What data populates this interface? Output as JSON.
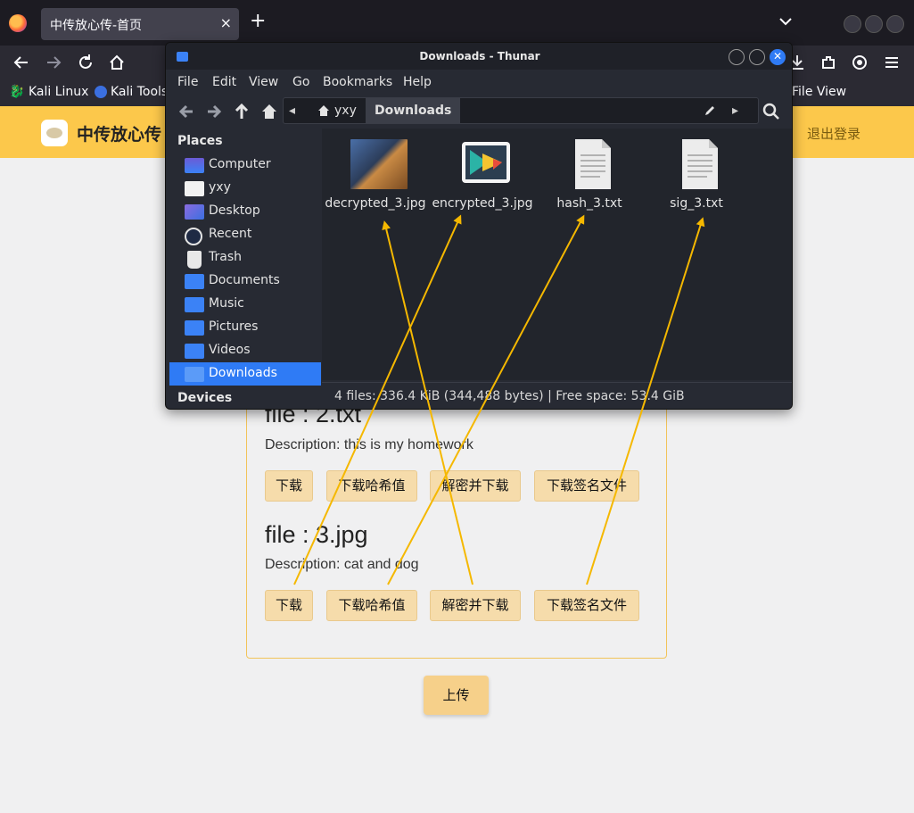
{
  "browser": {
    "tab_title": "中传放心传-首页",
    "tab_close": "×",
    "new_tab": "+",
    "bookmarks": [
      "Kali Linux",
      "Kali Tools",
      "File View"
    ]
  },
  "site": {
    "title": "中传放心传",
    "logout": "退出登录"
  },
  "files": [
    {
      "title": "file : 2.txt",
      "description": "Description: this is my homework",
      "buttons": [
        "下载",
        "下载哈希值",
        "解密并下载",
        "下载签名文件"
      ]
    },
    {
      "title": "file : 3.jpg",
      "description": "Description: cat and dog",
      "buttons": [
        "下载",
        "下载哈希值",
        "解密并下载",
        "下载签名文件"
      ]
    }
  ],
  "upload_button": "上传",
  "thunar": {
    "window_title": "Downloads - Thunar",
    "menu": [
      "File",
      "Edit",
      "View",
      "Go",
      "Bookmarks",
      "Help"
    ],
    "path": [
      "yxy",
      "Downloads"
    ],
    "places_header": "Places",
    "devices_header": "Devices",
    "places": [
      {
        "label": "Computer",
        "icon": "computer-icon"
      },
      {
        "label": "yxy",
        "icon": "home-folder-icon"
      },
      {
        "label": "Desktop",
        "icon": "desktop-icon"
      },
      {
        "label": "Recent",
        "icon": "recent-icon"
      },
      {
        "label": "Trash",
        "icon": "trash-icon"
      },
      {
        "label": "Documents",
        "icon": "documents-folder-icon"
      },
      {
        "label": "Music",
        "icon": "music-folder-icon"
      },
      {
        "label": "Pictures",
        "icon": "pictures-folder-icon"
      },
      {
        "label": "Videos",
        "icon": "videos-folder-icon"
      },
      {
        "label": "Downloads",
        "icon": "downloads-folder-icon"
      }
    ],
    "selected_place": "Downloads",
    "files": [
      {
        "name": "decrypted_3.jpg",
        "icon": "image-thumbnail-icon"
      },
      {
        "name": "encrypted_3.jpg",
        "icon": "image-file-icon"
      },
      {
        "name": "hash_3.txt",
        "icon": "text-file-icon"
      },
      {
        "name": "sig_3.txt",
        "icon": "text-file-icon"
      }
    ],
    "status": "4 files: 336.4 KiB (344,488 bytes)  |  Free space: 53.4 GiB"
  },
  "colors": {
    "header_yellow": "#fcc84b",
    "button_bg": "#f6dcab",
    "arrow": "#f5b800",
    "thunar_bg": "#272a33",
    "selection": "#2f7bf5"
  }
}
